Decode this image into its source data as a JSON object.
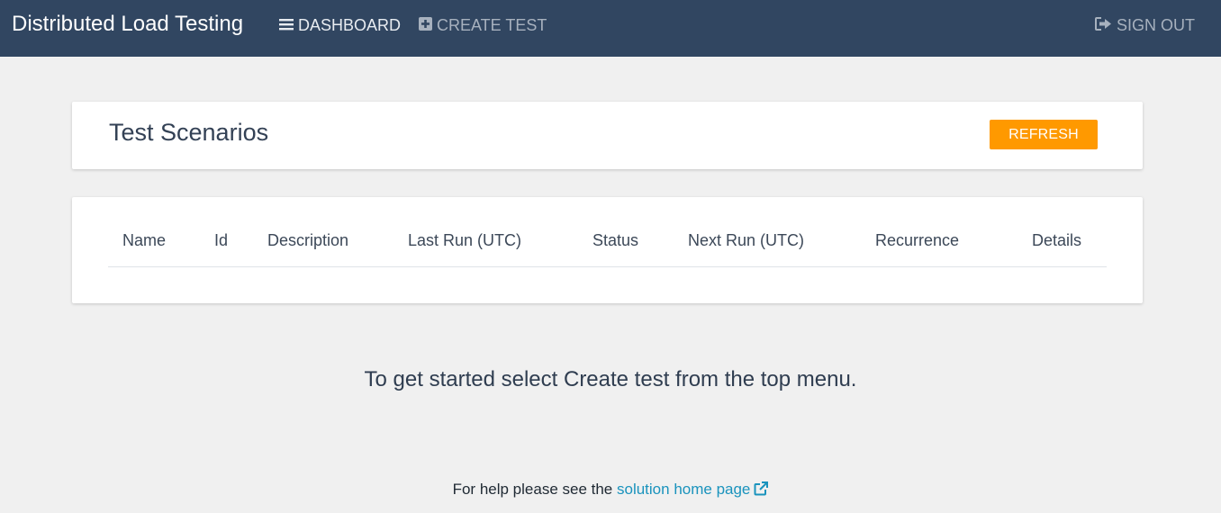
{
  "navbar": {
    "brand": "Distributed Load Testing",
    "links": [
      {
        "label": "DASHBOARD",
        "icon": "menu-icon"
      },
      {
        "label": "CREATE TEST",
        "icon": "plus-square-icon"
      },
      {
        "label": "SIGN OUT",
        "icon": "sign-out-icon"
      }
    ],
    "colors": {
      "background": "#314661"
    }
  },
  "header_card": {
    "title": "Test Scenarios",
    "refresh_label": "REFRESH",
    "refresh_color": "#ff9900"
  },
  "table": {
    "columns": [
      "Name",
      "Id",
      "Description",
      "Last Run (UTC)",
      "Status",
      "Next Run (UTC)",
      "Recurrence",
      "Details"
    ],
    "rows": []
  },
  "empty_message": "To get started select Create test from the top menu.",
  "help": {
    "prefix": "For help please see the ",
    "link_text": "solution home page",
    "link_icon": "external-link-icon"
  }
}
